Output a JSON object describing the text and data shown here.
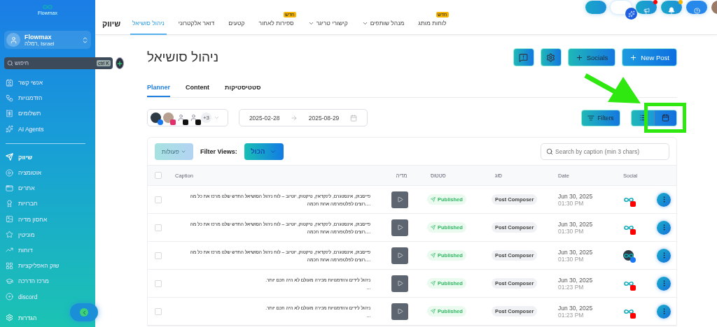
{
  "sidebar": {
    "logo_text": "Flowmax",
    "account": {
      "name": "Flowmax",
      "location": "רמלה, Israel"
    },
    "search": {
      "placeholder": "חיפוש",
      "shortcut": "ctrl K"
    },
    "groups": [
      [
        {
          "label": "אנשי קשר",
          "selected": false
        },
        {
          "label": "הזדמנויות",
          "selected": false
        },
        {
          "label": "תשלומים",
          "selected": false
        },
        {
          "label": "AI Agents",
          "selected": false
        }
      ],
      [
        {
          "label": "שיווק",
          "selected": true
        },
        {
          "label": "אוטומציה",
          "selected": false
        },
        {
          "label": "אתרים",
          "selected": false
        },
        {
          "label": "חברויות",
          "selected": false
        },
        {
          "label": "אחסון מדיה",
          "selected": false
        },
        {
          "label": "מוניטין",
          "selected": false
        },
        {
          "label": "דוחות",
          "selected": false
        },
        {
          "label": "שוק האפליקציות",
          "selected": false
        },
        {
          "label": "מרכז הדרכה",
          "selected": false
        },
        {
          "label": "discord",
          "selected": false
        }
      ]
    ],
    "settings": "הגדרות"
  },
  "topnav": {
    "section": "שיווק",
    "tabs": [
      {
        "label": "לוחות מותג",
        "selected": false,
        "badge": "חדש"
      },
      {
        "label": "מנהל שותפים",
        "selected": false,
        "has_menu": true
      },
      {
        "label": "קישורי טריגר",
        "selected": false,
        "has_menu": true
      },
      {
        "label": "ספירות לאחור",
        "selected": false,
        "badge": "חדש"
      },
      {
        "label": "קטעים",
        "selected": false
      },
      {
        "label": "דואר אלקטרוני",
        "selected": false
      },
      {
        "label": "ניהול סושיאל",
        "selected": true
      }
    ]
  },
  "page": {
    "title": "ניהול סושיאל",
    "buttons": [
      {
        "kind": "primary",
        "label": "New Post"
      },
      {
        "kind": "add",
        "label": "Socials"
      },
      {
        "kind": "settings"
      },
      {
        "kind": "feedback"
      }
    ],
    "tabs": [
      {
        "label": "סטטיסטיקות",
        "selected": false
      },
      {
        "label": "Content",
        "selected": false
      },
      {
        "label": "Planner",
        "selected": true
      }
    ],
    "accounts": [
      {
        "kind": "facebook"
      },
      {
        "kind": "instagram"
      },
      {
        "kind": "tiktok"
      },
      {
        "kind": "tiktok"
      }
    ],
    "accounts_more": "+3",
    "date_range": {
      "start": "2025-02-28",
      "end": "2025-08-29"
    },
    "filters_button": "Filters",
    "views": [
      {
        "kind": "list",
        "selected": false
      },
      {
        "kind": "calendar",
        "selected": true
      }
    ]
  },
  "table": {
    "actions": {
      "label": "פעולות",
      "disabled": true
    },
    "filter_views_label": "Filter Views:",
    "filter_view": "הכול",
    "search": {
      "placeholder": "Search by caption (min 3 chars)"
    },
    "select_all_checked": false,
    "columns": [
      "Social",
      "Date",
      "סוג",
      "סטטוס",
      "מדיה",
      "Caption"
    ],
    "rows": [
      {
        "checked": false,
        "caption": [
          "פייסבוק, אינסטגרם, לינקדאין, טיקטוק, יוטיוב – לוח ניהול הסושיאל החדש שלנו מרכז את כל מה",
          "....רוצים לפלטפורמה אחת חכמה"
        ],
        "status": "Published",
        "type": "Post Composer",
        "date": "Jun 30, 2025",
        "time": "01:30 PM",
        "social": {
          "kind": "youtube"
        }
      },
      {
        "checked": false,
        "caption": [
          "פייסבוק, אינסטגרם, לינקדאין, טיקטוק, יוטיוב – לוח ניהול הסושיאל החדש שלנו מרכז את כל מה",
          "....רוצים לפלטפורמה אחת חכמה"
        ],
        "status": "Published",
        "type": "Post Composer",
        "date": "Jun 30, 2025",
        "time": "01:30 PM",
        "social": {
          "kind": "youtube"
        }
      },
      {
        "checked": false,
        "caption": [
          "פייסבוק, אינסטגרם, לינקדאין, טיקטוק, יוטיוב – לוח ניהול הסושיאל החדש שלנו מרכז את כל מה",
          "....רוצים לפלטפורמה אחת חכמה"
        ],
        "status": "Published",
        "type": "Post Composer",
        "date": "Jun 30, 2025",
        "time": "01:30 PM",
        "social": {
          "kind": "facebook"
        }
      },
      {
        "checked": false,
        "caption": [
          "ניהול לידים והזדמנויות מכירה מעולם לא היה חכם יותר.",
          "..."
        ],
        "status": "Published",
        "type": "Post Composer",
        "date": "Jun 30, 2025",
        "time": "01:23 PM",
        "social": {
          "kind": "youtube"
        }
      },
      {
        "checked": false,
        "caption": [
          "ניהול לידים והזדמנויות מכירה מעולם לא היה חכם יותר.",
          "..."
        ],
        "status": "Published",
        "type": "Post Composer",
        "date": "Jun 30, 2025",
        "time": "01:23 PM",
        "social": {
          "kind": "youtube"
        }
      }
    ]
  }
}
